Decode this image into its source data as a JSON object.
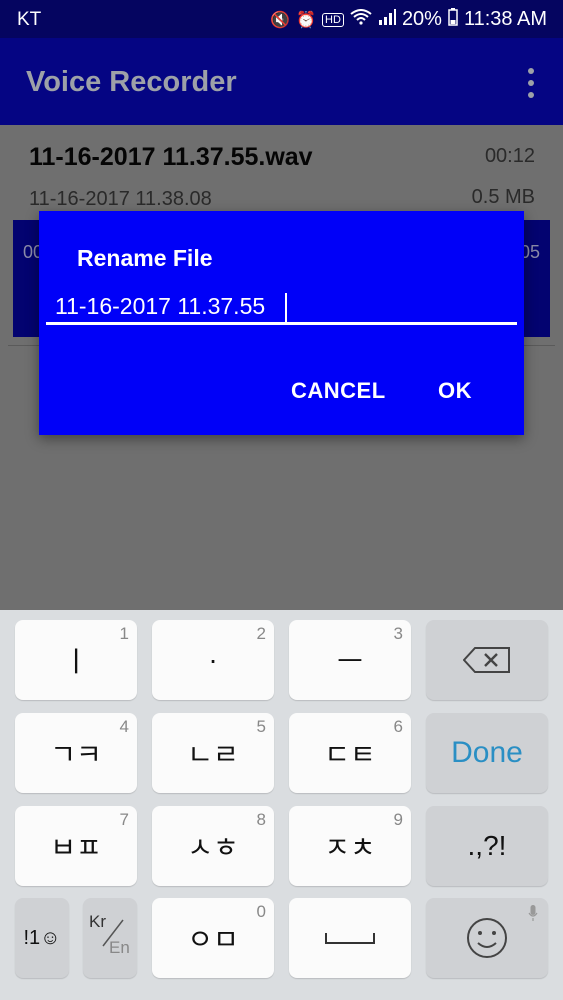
{
  "status_bar": {
    "carrier": "KT",
    "battery": "20%",
    "time": "11:38 AM"
  },
  "app_bar": {
    "title": "Voice Recorder"
  },
  "recordings": [
    {
      "name": "11-16-2017 11.37.55.wav",
      "duration": "00:12",
      "date": "11-16-2017 11.38.08",
      "size": "0.5 MB"
    }
  ],
  "player": {
    "time_left": "00",
    "time_right": "05"
  },
  "dialog": {
    "title": "Rename File",
    "value": "11-16-2017 11.37.55",
    "cancel_label": "CANCEL",
    "ok_label": "OK"
  },
  "keyboard": {
    "keys": [
      {
        "label": "ㅣ",
        "num": "1"
      },
      {
        "label": "·",
        "num": "2"
      },
      {
        "label": "ㅡ",
        "num": "3"
      },
      {
        "label": "ㄱㅋ",
        "num": "4"
      },
      {
        "label": "ㄴㄹ",
        "num": "5"
      },
      {
        "label": "ㄷㅌ",
        "num": "6"
      },
      {
        "label": "ㅂㅍ",
        "num": "7"
      },
      {
        "label": "ㅅㅎ",
        "num": "8"
      },
      {
        "label": "ㅈㅊ",
        "num": "9"
      },
      {
        "label": "ㅇㅁ",
        "num": "0"
      }
    ],
    "done_label": "Done",
    "punct_label": ".,?!",
    "symbols_label": "!1☺",
    "lang_kr": "Kr",
    "lang_en": "En",
    "icons": [
      "backspace-icon",
      "emoji-icon",
      "microphone-icon",
      "space-icon"
    ]
  }
}
